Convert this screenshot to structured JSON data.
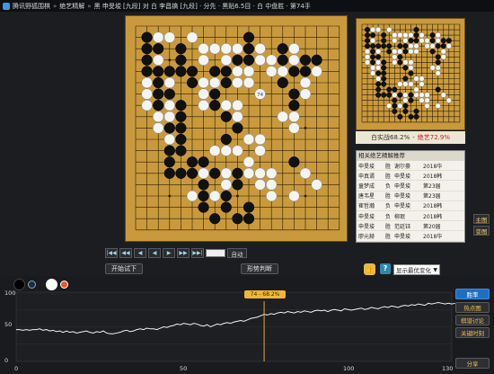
{
  "titlebar": {
    "app_name": "腾讯野狐围棋",
    "section": "绝艺精解",
    "game_info": "黑 申旻埈 [九段] 对 白 李昌镐 [九段] · 分先 · 黑贴6.5目 · 白 中盘胜 · 第74手"
  },
  "board": {
    "size": 19,
    "last_move_label": "74",
    "black_stones": [
      [
        1,
        1
      ],
      [
        1,
        2
      ],
      [
        1,
        3
      ],
      [
        1,
        4
      ],
      [
        2,
        2
      ],
      [
        2,
        4
      ],
      [
        2,
        5
      ],
      [
        2,
        6
      ],
      [
        2,
        7
      ],
      [
        3,
        9
      ],
      [
        3,
        11
      ],
      [
        4,
        2
      ],
      [
        4,
        3
      ],
      [
        4,
        7
      ],
      [
        4,
        8
      ],
      [
        4,
        9
      ],
      [
        4,
        10
      ],
      [
        4,
        11
      ],
      [
        3,
        12
      ],
      [
        3,
        13
      ],
      [
        4,
        13
      ],
      [
        5,
        12
      ],
      [
        5,
        13
      ],
      [
        6,
        12
      ],
      [
        6,
        14
      ],
      [
        6,
        15
      ],
      [
        6,
        16
      ],
      [
        7,
        13
      ],
      [
        7,
        17
      ],
      [
        3,
        6
      ],
      [
        3,
        4
      ],
      [
        5,
        4
      ],
      [
        4,
        4
      ],
      [
        5,
        5
      ],
      [
        7,
        4
      ],
      [
        8,
        4
      ],
      [
        9,
        3
      ],
      [
        10,
        2
      ],
      [
        10,
        3
      ],
      [
        10,
        1
      ],
      [
        8,
        5
      ],
      [
        7,
        6
      ],
      [
        7,
        7
      ],
      [
        8,
        8
      ],
      [
        9,
        9
      ],
      [
        8,
        10
      ],
      [
        9,
        13
      ],
      [
        9,
        14
      ],
      [
        8,
        15
      ],
      [
        8,
        16
      ],
      [
        9,
        17
      ],
      [
        10,
        16
      ],
      [
        10,
        17
      ],
      [
        13,
        2
      ],
      [
        13,
        3
      ],
      [
        14,
        4
      ],
      [
        13,
        5
      ],
      [
        14,
        6
      ],
      [
        14,
        7
      ],
      [
        15,
        3
      ],
      [
        15,
        4
      ],
      [
        16,
        3
      ],
      [
        14,
        12
      ]
    ],
    "white_stones": [
      [
        1,
        5
      ],
      [
        1,
        6
      ],
      [
        1,
        7
      ],
      [
        2,
        1
      ],
      [
        2,
        3
      ],
      [
        2,
        8
      ],
      [
        3,
        1
      ],
      [
        3,
        5
      ],
      [
        3,
        7
      ],
      [
        3,
        8
      ],
      [
        3,
        10
      ],
      [
        2,
        9
      ],
      [
        5,
        1
      ],
      [
        6,
        3
      ],
      [
        6,
        2
      ],
      [
        7,
        2
      ],
      [
        8,
        2
      ],
      [
        9,
        2
      ],
      [
        10,
        4
      ],
      [
        11,
        2
      ],
      [
        11,
        3
      ],
      [
        12,
        3
      ],
      [
        12,
        4
      ],
      [
        13,
        4
      ],
      [
        14,
        3
      ],
      [
        14,
        2
      ],
      [
        8,
        3
      ],
      [
        9,
        4
      ],
      [
        9,
        5
      ],
      [
        10,
        5
      ],
      [
        7,
        5
      ],
      [
        6,
        5
      ],
      [
        6,
        6
      ],
      [
        6,
        7
      ],
      [
        8,
        7
      ],
      [
        9,
        7
      ],
      [
        9,
        8
      ],
      [
        11,
        10
      ],
      [
        11,
        11
      ],
      [
        10,
        12
      ],
      [
        10,
        13
      ],
      [
        11,
        13
      ],
      [
        11,
        14
      ],
      [
        12,
        13
      ],
      [
        12,
        14
      ],
      [
        12,
        15
      ],
      [
        8,
        11
      ],
      [
        8,
        13
      ],
      [
        7,
        11
      ],
      [
        14,
        8
      ],
      [
        14,
        9
      ],
      [
        13,
        8
      ],
      [
        16,
        14
      ],
      [
        15,
        13
      ],
      [
        14,
        15
      ],
      [
        10,
        10
      ],
      [
        9,
        11
      ],
      [
        8,
        14
      ],
      [
        7,
        15
      ],
      [
        6,
        13
      ],
      [
        5,
        15
      ],
      [
        16,
        4
      ],
      [
        15,
        5
      ],
      [
        15,
        6
      ]
    ]
  },
  "winrate": {
    "label_side": "白实战68.2%",
    "sep": "-",
    "label_ai": "绝艺72.9%"
  },
  "related": {
    "header": "相关绝艺精解推荐",
    "rows": [
      {
        "p1": "申旻埈",
        "res": "胜",
        "p2": "谢尔豪",
        "tag": "2018华"
      },
      {
        "p1": "申真谞",
        "res": "胜",
        "p2": "申旻埈",
        "tag": "2018韩"
      },
      {
        "p1": "童梦成",
        "res": "负",
        "p2": "申旻埈",
        "tag": "第23届"
      },
      {
        "p1": "唐韦星",
        "res": "胜",
        "p2": "申旻埈",
        "tag": "第23届"
      },
      {
        "p1": "崔哲瀚",
        "res": "负",
        "p2": "申旻埈",
        "tag": "2018韩"
      },
      {
        "p1": "申旻埈",
        "res": "负",
        "p2": "柳珉",
        "tag": "2018韩"
      },
      {
        "p1": "申旻埈",
        "res": "胜",
        "p2": "范廷钰",
        "tag": "第20届"
      },
      {
        "p1": "廖元赫",
        "res": "胜",
        "p2": "申旻埈",
        "tag": "2018华"
      }
    ]
  },
  "side_buttons": {
    "main": "主图",
    "variation": "变图"
  },
  "controls": {
    "icons": [
      "|◀◀",
      "◀◀",
      "◀",
      "◀",
      "▶",
      "▶▶",
      "▶▶|"
    ],
    "auto_label": "自动"
  },
  "actions": {
    "try_label": "开始试下",
    "judge_label": "形势判断",
    "show_change_label": "显示最优变化"
  },
  "graph": {
    "y_labels": [
      "100",
      "50",
      "0"
    ],
    "x_labels": [
      "0",
      "50",
      "100",
      "130"
    ],
    "tooltip": "74 - 68.2%",
    "cursor_move": 74,
    "winrate_series": [
      46,
      46,
      45,
      46,
      45,
      46,
      46,
      47,
      45,
      46,
      44,
      45,
      43,
      44,
      42,
      44,
      42,
      43,
      41,
      42,
      43,
      44,
      42,
      41,
      43,
      42,
      44,
      41,
      40,
      40,
      41,
      42,
      44,
      45,
      43,
      44,
      46,
      47,
      46,
      48,
      47,
      47,
      46,
      48,
      50,
      49,
      51,
      52,
      54,
      53,
      55,
      54,
      53,
      55,
      54,
      52,
      51,
      53,
      50,
      52,
      54,
      53,
      55,
      56,
      55,
      57,
      58,
      59,
      58,
      60,
      62,
      63,
      64,
      66,
      68,
      67,
      69,
      68,
      70,
      71,
      70,
      72,
      71,
      70,
      72,
      71,
      73,
      72,
      71,
      73,
      74,
      73,
      74,
      72,
      74,
      75,
      74,
      73,
      76,
      75,
      74,
      75,
      76,
      77,
      75,
      76,
      78,
      77,
      76,
      78,
      79,
      78,
      80,
      79,
      78,
      80,
      81,
      80,
      82,
      81,
      83,
      82,
      81,
      84,
      83,
      84,
      85,
      84,
      83,
      84,
      83,
      84
    ]
  },
  "right_buttons": {
    "winrate": "胜率",
    "hot": "热点图",
    "kifu": "棋谱讨论",
    "key": "关键时刻",
    "share": "分享"
  }
}
